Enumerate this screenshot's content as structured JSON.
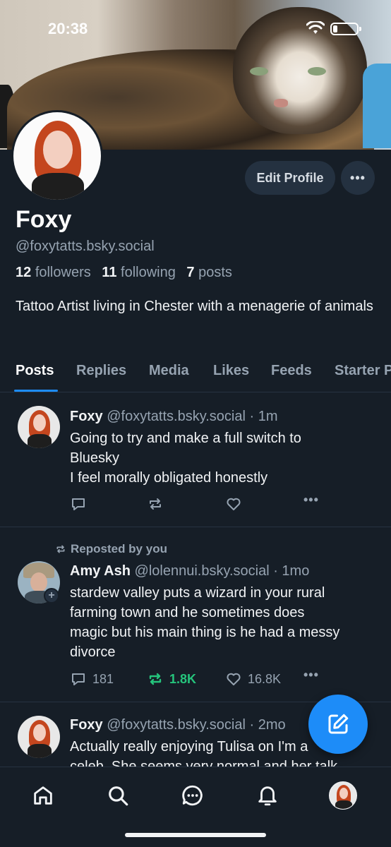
{
  "status_bar": {
    "time": "20:38"
  },
  "profile": {
    "name": "Foxy",
    "handle": "@foxytatts.bsky.social",
    "followers_count": "12",
    "followers_label": "followers",
    "following_count": "11",
    "following_label": "following",
    "posts_count": "7",
    "posts_label": "posts",
    "bio": "Tattoo Artist living in Chester with a menagerie of animals",
    "edit_button": "Edit Profile",
    "more_button": "•••"
  },
  "tabs": [
    {
      "label": "Posts",
      "active": true
    },
    {
      "label": "Replies",
      "active": false
    },
    {
      "label": "Media",
      "active": false
    },
    {
      "label": "Likes",
      "active": false
    },
    {
      "label": "Feeds",
      "active": false
    },
    {
      "label": "Starter Packs",
      "active": false
    }
  ],
  "posts": [
    {
      "author": "Foxy",
      "handle": "@foxytatts.bsky.social",
      "time": "· 1m",
      "lines": [
        "Going to try and make a full switch to",
        "Bluesky",
        "I feel morally obligated honestly"
      ],
      "replies": "",
      "reposts": "",
      "likes": ""
    },
    {
      "repost_label": "Reposted by you",
      "author": "Amy Ash",
      "handle": "@lolennui.bsky.social",
      "time": "· 1mo",
      "lines": [
        "stardew valley puts a wizard in your rural",
        "farming town and he sometimes does",
        "magic but his main thing is he had a messy",
        "divorce"
      ],
      "replies": "181",
      "reposts": "1.8K",
      "likes": "16.8K"
    },
    {
      "author": "Foxy",
      "handle": "@foxytatts.bsky.social",
      "time": "· 2mo",
      "lines": [
        "Actually really enjoying Tulisa on I'm a",
        "celeb. She seems very normal and her talk"
      ]
    }
  ],
  "colors": {
    "accent": "#1d8cf8",
    "repost_active": "#25c47c",
    "background": "#161e27"
  }
}
